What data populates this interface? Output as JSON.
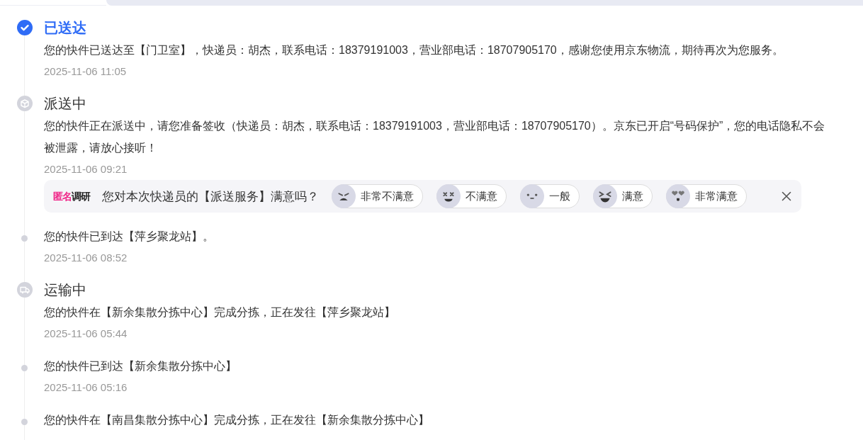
{
  "timeline": [
    {
      "kind": "delivered",
      "title": "已送达",
      "text": "您的快件已送达至【门卫室】，快递员：胡杰，联系电话：18379191003，营业部电话：18707905170，感谢您使用京东物流，期待再次为您服务。",
      "time": "2025-11-06 11:05"
    },
    {
      "kind": "dispatching",
      "title": "派送中",
      "text": "您的快件正在派送中，请您准备签收（快递员：胡杰，联系电话：18379191003，营业部电话：18707905170）。京东已开启“号码保护”，您的电话隐私不会被泄露，请放心接听！",
      "time": "2025-11-06 09:21",
      "survey": {
        "logo_accent": "匿名",
        "logo_rest": "调研",
        "question": "您对本次快递员的【派送服务】满意吗？",
        "options": [
          {
            "kind": "very_unsatisfied",
            "label": "非常不满意"
          },
          {
            "kind": "unsatisfied",
            "label": "不满意"
          },
          {
            "kind": "neutral",
            "label": "一般"
          },
          {
            "kind": "satisfied",
            "label": "满意"
          },
          {
            "kind": "very_satisfied",
            "label": "非常满意"
          }
        ]
      }
    },
    {
      "kind": "step",
      "text": "您的快件已到达【萍乡聚龙站】。",
      "time": "2025-11-06 08:52"
    },
    {
      "kind": "transit",
      "title": "运输中",
      "text": "您的快件在【新余集散分拣中心】完成分拣，正在发往【萍乡聚龙站】",
      "time": "2025-11-06 05:44"
    },
    {
      "kind": "step",
      "text": "您的快件已到达【新余集散分拣中心】",
      "time": "2025-11-06 05:16"
    },
    {
      "kind": "step",
      "text": "您的快件在【南昌集散分拣中心】完成分拣，正在发往【新余集散分拣中心】"
    }
  ]
}
